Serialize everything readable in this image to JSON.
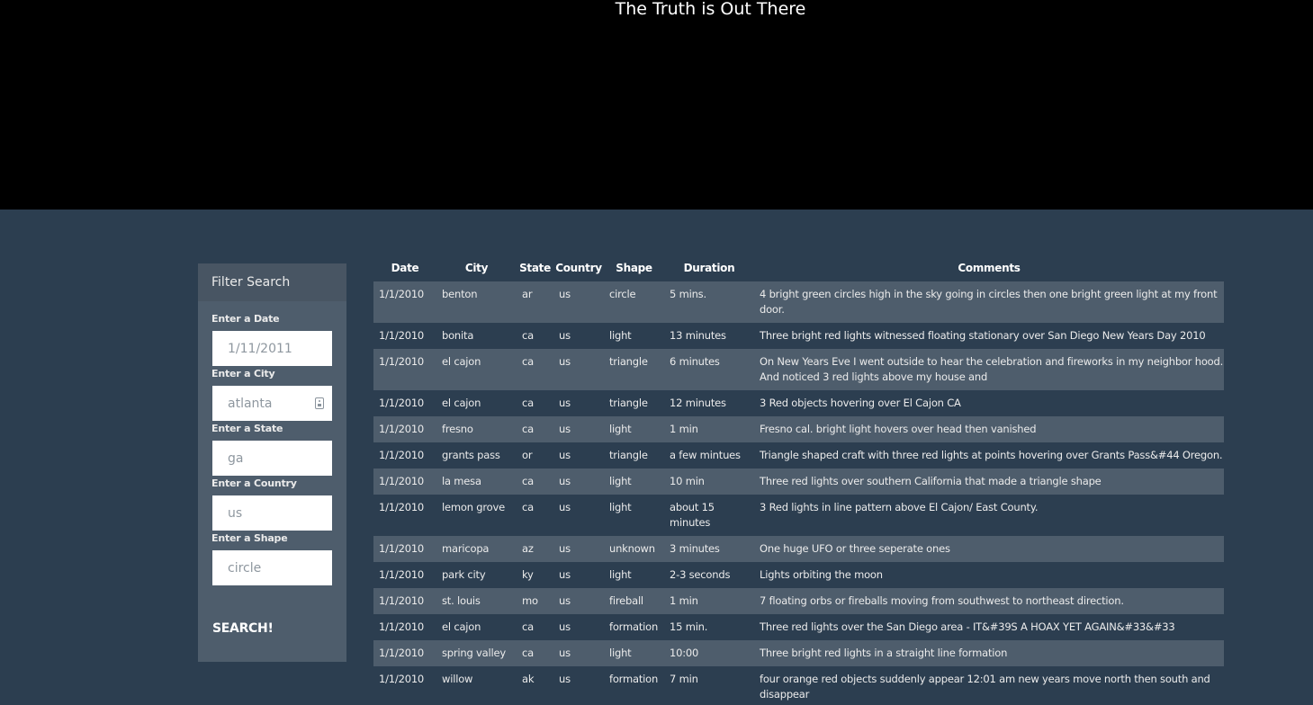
{
  "hero": {
    "title": "The Truth is Out There"
  },
  "filter": {
    "heading": "Filter Search",
    "fields": [
      {
        "label": "Enter a Date",
        "placeholder": "1/11/2011"
      },
      {
        "label": "Enter a City",
        "placeholder": "atlanta"
      },
      {
        "label": "Enter a State",
        "placeholder": "ga"
      },
      {
        "label": "Enter a Country",
        "placeholder": "us"
      },
      {
        "label": "Enter a Shape",
        "placeholder": "circle"
      }
    ],
    "button_label": "SEARCH!"
  },
  "table": {
    "headers": [
      "Date",
      "City",
      "State",
      "Country",
      "Shape",
      "Duration",
      "Comments"
    ],
    "rows": [
      [
        "1/1/2010",
        "benton",
        "ar",
        "us",
        "circle",
        "5 mins.",
        "4 bright green circles high in the sky going in circles then one bright green light at my front door."
      ],
      [
        "1/1/2010",
        "bonita",
        "ca",
        "us",
        "light",
        "13 minutes",
        "Three bright red lights witnessed floating stationary over San Diego New Years Day 2010"
      ],
      [
        "1/1/2010",
        "el cajon",
        "ca",
        "us",
        "triangle",
        "6 minutes",
        "On New Years Eve I went outside to hear the celebration and fireworks in my neighbor hood. And noticed 3 red lights above my house and"
      ],
      [
        "1/1/2010",
        "el cajon",
        "ca",
        "us",
        "triangle",
        "12 minutes",
        "3 Red objects hovering over El Cajon CA"
      ],
      [
        "1/1/2010",
        "fresno",
        "ca",
        "us",
        "light",
        "1 min",
        "Fresno cal. bright light hovers over head then vanished"
      ],
      [
        "1/1/2010",
        "grants pass",
        "or",
        "us",
        "triangle",
        "a few mintues",
        "Triangle shaped craft with three red lights at points hovering over Grants Pass&#44 Oregon."
      ],
      [
        "1/1/2010",
        "la mesa",
        "ca",
        "us",
        "light",
        "10 min",
        "Three red lights over southern California that made a triangle shape"
      ],
      [
        "1/1/2010",
        "lemon grove",
        "ca",
        "us",
        "light",
        "about 15 minutes",
        "3 Red lights in line pattern above El Cajon/ East County."
      ],
      [
        "1/1/2010",
        "maricopa",
        "az",
        "us",
        "unknown",
        "3 minutes",
        "One huge UFO or three seperate ones"
      ],
      [
        "1/1/2010",
        "park city",
        "ky",
        "us",
        "light",
        "2-3 seconds",
        "Lights orbiting the moon"
      ],
      [
        "1/1/2010",
        "st. louis",
        "mo",
        "us",
        "fireball",
        "1 min",
        "7 floating orbs or fireballs moving from southwest to northeast direction."
      ],
      [
        "1/1/2010",
        "el cajon",
        "ca",
        "us",
        "formation",
        "15 min.",
        "Three red lights over the San Diego area - IT&#39S A HOAX YET AGAIN&#33&#33"
      ],
      [
        "1/1/2010",
        "spring valley",
        "ca",
        "us",
        "light",
        "10:00",
        "Three bright red lights in a straight line formation"
      ],
      [
        "1/1/2010",
        "willow",
        "ak",
        "us",
        "formation",
        "7 min",
        "four orange red objects suddenly appear 12:01 am new years move north then south and disappear"
      ]
    ]
  }
}
